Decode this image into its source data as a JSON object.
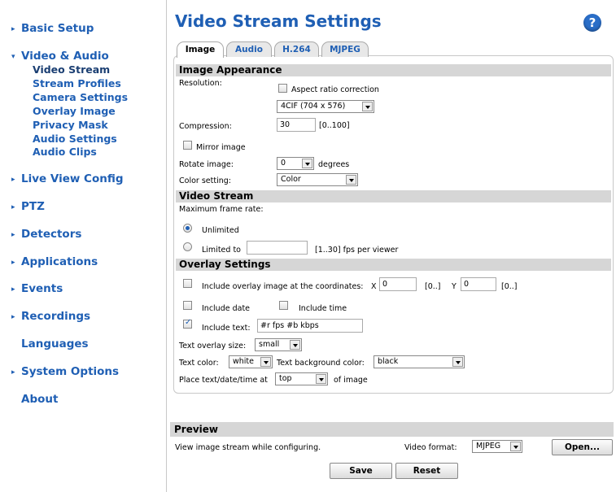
{
  "sidebar": {
    "items": [
      {
        "label": "Basic Setup",
        "arrow": "▸"
      },
      {
        "label": "Video & Audio",
        "arrow": "▾"
      },
      {
        "label": "Live View Config",
        "arrow": "▸"
      },
      {
        "label": "PTZ",
        "arrow": "▸"
      },
      {
        "label": "Detectors",
        "arrow": "▸"
      },
      {
        "label": "Applications",
        "arrow": "▸"
      },
      {
        "label": "Events",
        "arrow": "▸"
      },
      {
        "label": "Recordings",
        "arrow": "▸"
      },
      {
        "label": "Languages",
        "arrow": ""
      },
      {
        "label": "System Options",
        "arrow": "▸"
      },
      {
        "label": "About",
        "arrow": ""
      }
    ],
    "subitems": [
      "Video Stream",
      "Stream Profiles",
      "Camera Settings",
      "Overlay Image",
      "Privacy Mask",
      "Audio Settings",
      "Audio Clips"
    ]
  },
  "header": {
    "title": "Video Stream Settings",
    "help_glyph": "?"
  },
  "tabs": [
    "Image",
    "Audio",
    "H.264",
    "MJPEG"
  ],
  "image_appearance": {
    "section": "Image Appearance",
    "resolution_label": "Resolution:",
    "aspect_label": "Aspect ratio correction",
    "aspect_checked": false,
    "resolution_value": "4CIF (704 x 576)",
    "compression_label": "Compression:",
    "compression_value": "30",
    "compression_range": "[0..100]",
    "mirror_label": "Mirror image",
    "mirror_checked": false,
    "rotate_label": "Rotate image:",
    "rotate_value": "0",
    "rotate_unit": "degrees",
    "color_label": "Color setting:",
    "color_value": "Color"
  },
  "video_stream": {
    "section": "Video Stream",
    "max_frame_label": "Maximum frame rate:",
    "unlimited_label": "Unlimited",
    "limited_label": "Limited to",
    "limited_value": "",
    "fps_range": "[1..30] fps per viewer",
    "selected": "unlimited"
  },
  "overlay": {
    "section": "Overlay Settings",
    "include_image_label": "Include overlay image at the coordinates:",
    "x_label": "X",
    "x_value": "0",
    "x_range": "[0..]",
    "y_label": "Y",
    "y_value": "0",
    "y_range": "[0..]",
    "include_date_label": "Include date",
    "include_time_label": "Include time",
    "include_text_label": "Include text:",
    "include_text_checked": true,
    "text_value": "#r fps #b kbps",
    "size_label": "Text overlay size:",
    "size_value": "small",
    "text_color_label": "Text color:",
    "text_color_value": "white",
    "bg_color_label": "Text background color:",
    "bg_color_value": "black",
    "place_label": "Place text/date/time at",
    "place_value": "top",
    "place_suffix": "of image"
  },
  "preview": {
    "section": "Preview",
    "desc": "View image stream while configuring.",
    "format_label": "Video format:",
    "format_value": "MJPEG",
    "open_label": "Open..."
  },
  "actions": {
    "save": "Save",
    "reset": "Reset"
  },
  "colors": {
    "accent": "#1f5fb4",
    "section_bg": "#d6d6d6"
  }
}
